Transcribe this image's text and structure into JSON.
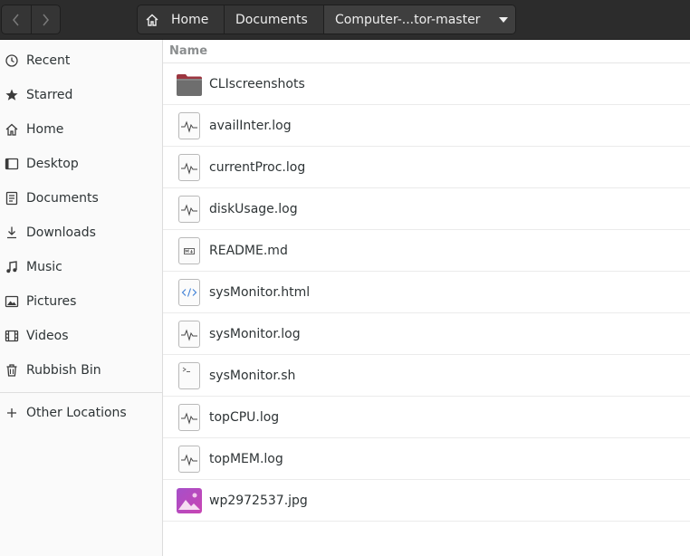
{
  "header": {
    "back_icon": "chevron-left-icon",
    "forward_icon": "chevron-right-icon",
    "breadcrumb": {
      "home": "Home",
      "documents": "Documents",
      "current": "Computer-...tor-master"
    }
  },
  "sidebar": {
    "items": [
      {
        "label": "Recent",
        "icon": "clock-icon"
      },
      {
        "label": "Starred",
        "icon": "star-icon"
      },
      {
        "label": "Home",
        "icon": "home-icon"
      },
      {
        "label": "Desktop",
        "icon": "desktop-icon"
      },
      {
        "label": "Documents",
        "icon": "document-icon"
      },
      {
        "label": "Downloads",
        "icon": "download-icon"
      },
      {
        "label": "Music",
        "icon": "music-icon"
      },
      {
        "label": "Pictures",
        "icon": "picture-icon"
      },
      {
        "label": "Videos",
        "icon": "video-icon"
      },
      {
        "label": "Rubbish Bin",
        "icon": "trash-icon"
      },
      {
        "label": "Other Locations",
        "icon": "plus-icon"
      }
    ]
  },
  "files": {
    "column_name": "Name",
    "rows": [
      {
        "name": "CLIscreenshots",
        "type": "folder"
      },
      {
        "name": "availInter.log",
        "type": "log"
      },
      {
        "name": "currentProc.log",
        "type": "log"
      },
      {
        "name": "diskUsage.log",
        "type": "log"
      },
      {
        "name": "README.md",
        "type": "markdown"
      },
      {
        "name": "sysMonitor.html",
        "type": "html"
      },
      {
        "name": "sysMonitor.log",
        "type": "log"
      },
      {
        "name": "sysMonitor.sh",
        "type": "script"
      },
      {
        "name": "topCPU.log",
        "type": "log"
      },
      {
        "name": "topMEM.log",
        "type": "log"
      },
      {
        "name": "wp2972537.jpg",
        "type": "image"
      }
    ]
  }
}
